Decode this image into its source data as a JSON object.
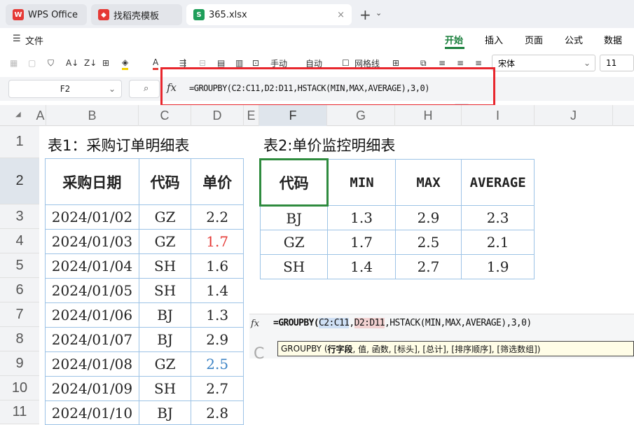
{
  "tabs": [
    {
      "label": "WPS Office"
    },
    {
      "label": "找稻壳模板"
    },
    {
      "label": "365.xlsx"
    }
  ],
  "menu": {
    "file": "文件"
  },
  "ribbon_tabs": [
    "开始",
    "插入",
    "页面",
    "公式",
    "数据"
  ],
  "toolbar": {
    "manual": "手动",
    "auto": "自动",
    "gridlines": "网格线",
    "font": "宋体",
    "size": "11"
  },
  "formula_bar": {
    "cell": "F2",
    "fx": "fx",
    "formula": "=GROUPBY(C2:C11,D2:D11,HSTACK(MIN,MAX,AVERAGE),3,0)"
  },
  "columns": [
    "A",
    "B",
    "C",
    "D",
    "E",
    "F",
    "G",
    "H",
    "I",
    "J"
  ],
  "rows": [
    "1",
    "2",
    "3",
    "4",
    "5",
    "6",
    "7",
    "8",
    "9",
    "10",
    "11"
  ],
  "table1": {
    "title": "表1：采购订单明细表",
    "headers": [
      "采购日期",
      "代码",
      "单价"
    ],
    "rows": [
      [
        "2024/01/02",
        "GZ",
        "2.2"
      ],
      [
        "2024/01/03",
        "GZ",
        "1.7"
      ],
      [
        "2024/01/04",
        "SH",
        "1.6"
      ],
      [
        "2024/01/05",
        "SH",
        "1.4"
      ],
      [
        "2024/01/06",
        "BJ",
        "1.3"
      ],
      [
        "2024/01/07",
        "BJ",
        "2.9"
      ],
      [
        "2024/01/08",
        "GZ",
        "2.5"
      ],
      [
        "2024/01/09",
        "SH",
        "2.7"
      ],
      [
        "2024/01/10",
        "BJ",
        "2.8"
      ]
    ],
    "highlight_colors": {
      "red": "#e53935",
      "blue": "#3b82c4"
    }
  },
  "table2": {
    "title": "表2:单价监控明细表",
    "headers": [
      "代码",
      "MIN",
      "MAX",
      "AVERAGE"
    ],
    "rows": [
      [
        "BJ",
        "1.3",
        "2.9",
        "2.3"
      ],
      [
        "GZ",
        "1.7",
        "2.5",
        "2.1"
      ],
      [
        "SH",
        "1.4",
        "2.7",
        "1.9"
      ]
    ]
  },
  "popup": {
    "fx": "fx",
    "prefix": "=GROUPBY(",
    "arg1": "C2:C11",
    "sep1": ",",
    "arg2": "D2:D11",
    "rest": ",HSTACK(MIN,MAX,AVERAGE),3,0)",
    "tooltip_prefix": "GROUPBY (",
    "tooltip_bold": "行字段",
    "tooltip_rest": ", 值, 函数, [标头], [总计], [排序顺序], [筛选数组])"
  }
}
